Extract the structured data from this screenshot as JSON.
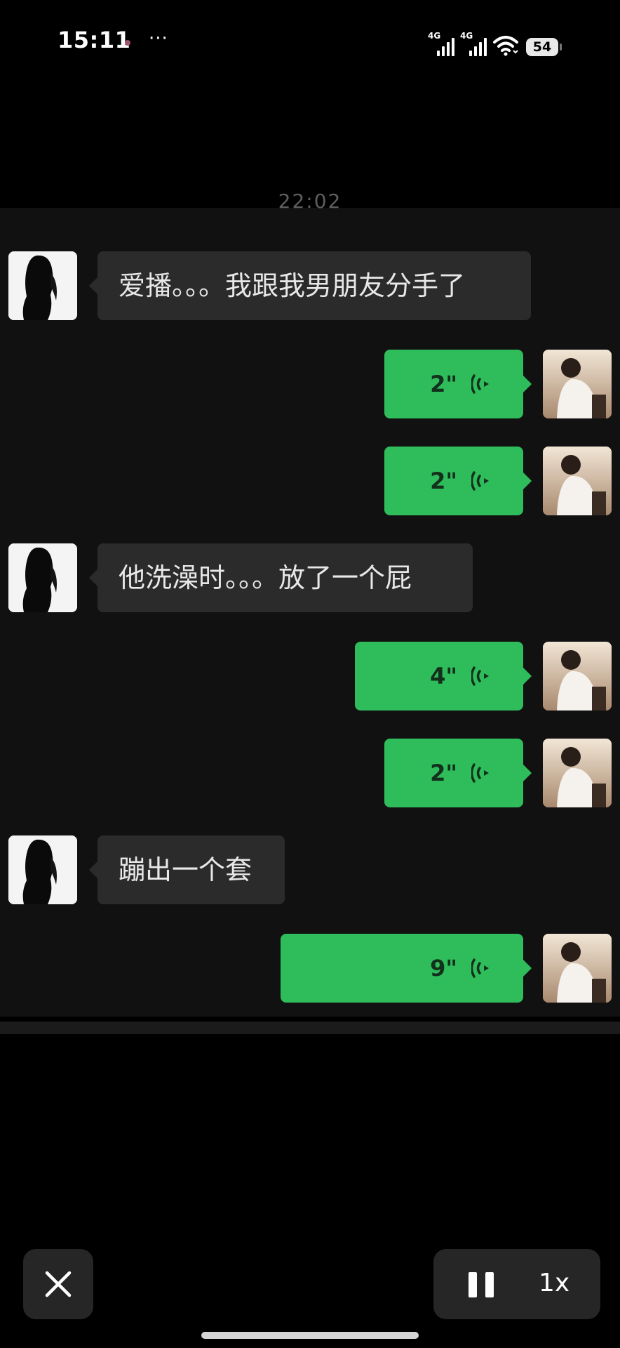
{
  "status_bar": {
    "time": "15:11",
    "more": "···",
    "network_1": "4G",
    "network_2": "4G",
    "battery": "54"
  },
  "chat": {
    "timestamp": "22:02",
    "colors": {
      "background": "#111111",
      "incoming_bubble": "#2b2b2b",
      "outgoing_bubble": "#2fbd5c"
    },
    "messages": [
      {
        "side": "left",
        "type": "text",
        "text": "爱播。。。我跟我男朋友分手了"
      },
      {
        "side": "right",
        "type": "voice",
        "duration": "2\""
      },
      {
        "side": "right",
        "type": "voice",
        "duration": "2\""
      },
      {
        "side": "left",
        "type": "text",
        "text": "他洗澡时。。。放了一个屁"
      },
      {
        "side": "right",
        "type": "voice",
        "duration": "4\""
      },
      {
        "side": "right",
        "type": "voice",
        "duration": "2\""
      },
      {
        "side": "left",
        "type": "text",
        "text": "蹦出一个套"
      },
      {
        "side": "right",
        "type": "voice",
        "duration": "9\""
      }
    ]
  },
  "player": {
    "close_icon": "close-icon",
    "pause_icon": "pause-icon",
    "speed": "1x"
  }
}
